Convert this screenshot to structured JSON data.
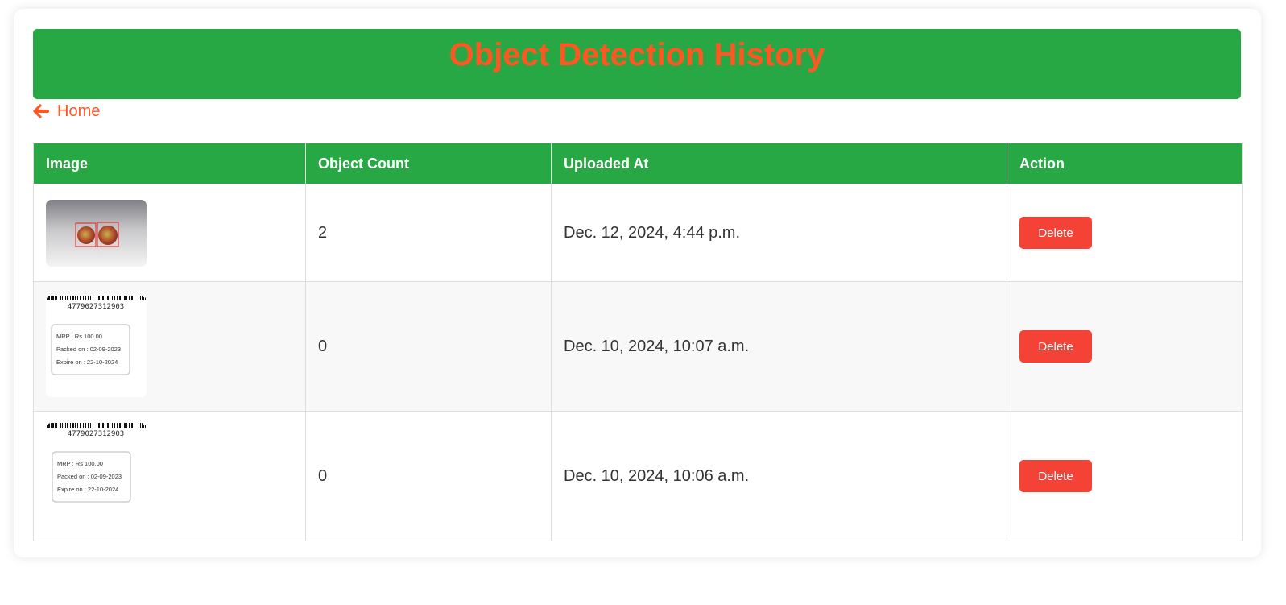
{
  "page": {
    "title": "Object Detection History",
    "home_link": "Home"
  },
  "colors": {
    "header_bg": "#28a745",
    "title": "#fe5722",
    "delete_bg": "#f44336"
  },
  "table": {
    "headers": [
      "Image",
      "Object Count",
      "Uploaded At",
      "Action"
    ],
    "rows": [
      {
        "image": "apples-detection",
        "object_count": "2",
        "uploaded_at": "Dec. 12, 2024, 4:44 p.m.",
        "action": "Delete"
      },
      {
        "image": "product-label",
        "object_count": "0",
        "uploaded_at": "Dec. 10, 2024, 10:07 a.m.",
        "action": "Delete",
        "label": {
          "barcode_number": "4779027312903",
          "mrp": "MRP : Rs 100.00",
          "packed": "Packed on : 02-09-2023",
          "expire": "Expire on : 22-10-2024"
        }
      },
      {
        "image": "product-label",
        "object_count": "0",
        "uploaded_at": "Dec. 10, 2024, 10:06 a.m.",
        "action": "Delete",
        "label": {
          "barcode_number": "4779027312903",
          "mrp": "MRP : Rs 100.00",
          "packed": "Packed on : 02-09-2023",
          "expire": "Expire on : 22-10-2024"
        }
      }
    ]
  }
}
